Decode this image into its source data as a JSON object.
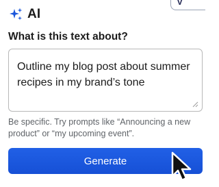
{
  "header": {
    "title": "AI",
    "icon": "sparkles-icon",
    "icon_color": "#1a56db"
  },
  "corner_card": {
    "letter": "V"
  },
  "prompt": {
    "question": "What is this text about?",
    "value": "Outline my blog post about summer recipes in my brand’s tone"
  },
  "hint": "Be specific. Try prompts like “Announcing a new product” or “my upcoming event”.",
  "actions": {
    "generate_label": "Generate",
    "button_color": "#1a56db"
  },
  "cursor": {
    "icon": "mouse-pointer-icon"
  }
}
